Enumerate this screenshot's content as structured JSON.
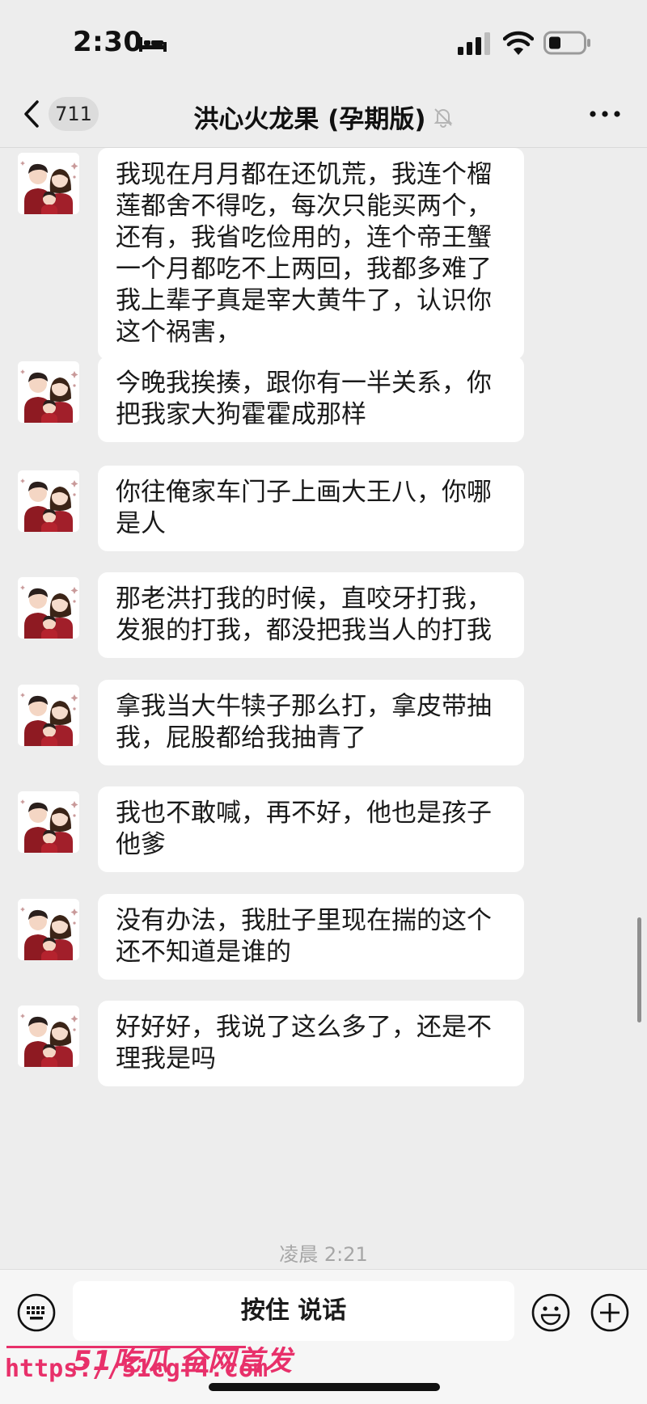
{
  "status_bar": {
    "time": "2:30",
    "icons": [
      "bed-icon",
      "signal-icon",
      "wifi-icon",
      "battery-icon"
    ]
  },
  "header": {
    "back_icon": "chevron-left-icon",
    "unread_count": "711",
    "title": "洪心火龙果 (孕期版)",
    "mute_icon": "bell-muted-icon",
    "more_icon": "ellipsis-icon"
  },
  "messages": [
    {
      "text": "我现在月月都在还饥荒，我连个榴莲都舍不得吃，每次只能买两个，还有，我省吃俭用的，连个帝王蟹一个月都吃不上两回，我都多难了我上辈子真是宰大黄牛了，认识你这个祸害，",
      "sender": "other"
    },
    {
      "text": "今晚我挨揍，跟你有一半关系，你把我家大狗霍霍成那样",
      "sender": "other"
    },
    {
      "text": "你往俺家车门子上画大王八，你哪是人",
      "sender": "other"
    },
    {
      "text": "那老洪打我的时候，直咬牙打我，发狠的打我，都没把我当人的打我",
      "sender": "other"
    },
    {
      "text": "拿我当大牛犊子那么打，拿皮带抽我，屁股都给我抽青了",
      "sender": "other"
    },
    {
      "text": "我也不敢喊，再不好，他也是孩子他爹",
      "sender": "other"
    },
    {
      "text": "没有办法，我肚子里现在揣的这个还不知道是谁的",
      "sender": "other"
    },
    {
      "text": "好好好，我说了这么多了，还是不理我是吗",
      "sender": "other"
    }
  ],
  "timestamp": "凌晨 2:21",
  "input_bar": {
    "hold_to_talk": "按住 说话",
    "left_icon": "keyboard-icon",
    "right_icons": [
      "emoji-icon",
      "plus-icon"
    ]
  },
  "watermark": {
    "brand": "51吃瓜 全网首发",
    "url": "https://51cgf4.com"
  },
  "colors": {
    "background": "#ededed",
    "bubble": "#ffffff",
    "watermark": "#e8306a"
  }
}
